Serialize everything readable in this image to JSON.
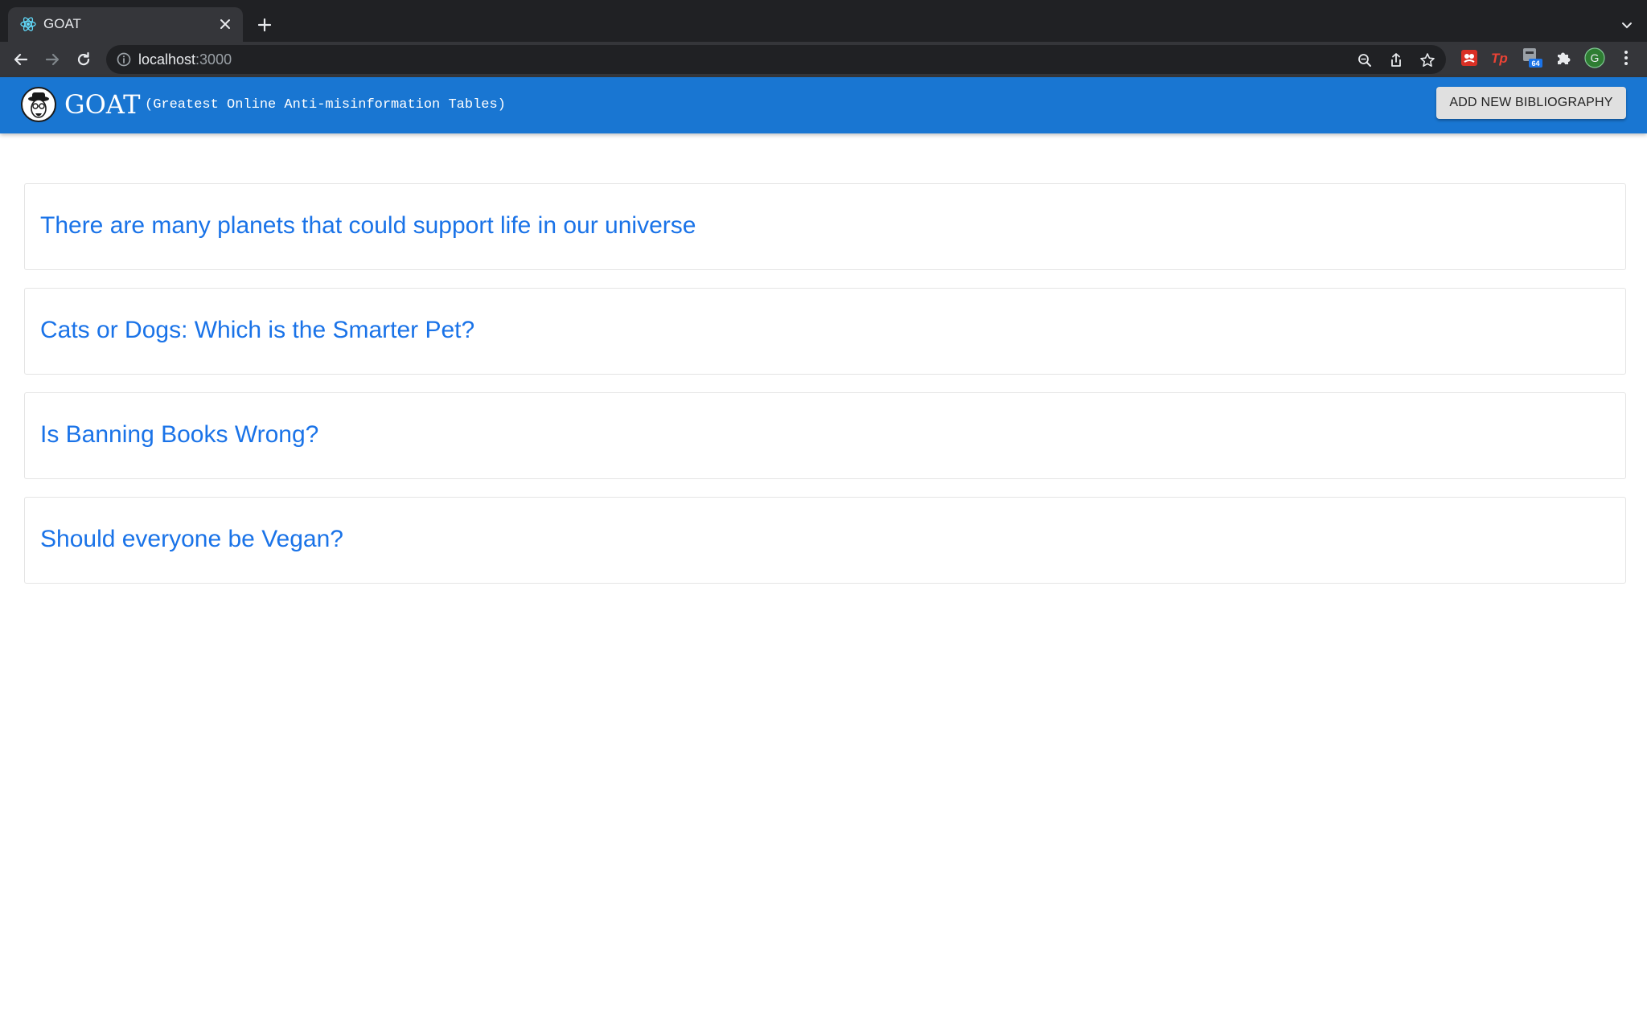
{
  "browser": {
    "tab_title": "GOAT",
    "url_host": "localhost",
    "url_port": ":3000",
    "extension_badge": "64",
    "profile_initial": "G",
    "colors": {
      "chrome_dark": "#202124",
      "toolbar": "#35363a",
      "profile_bg": "#2e7d32"
    }
  },
  "header": {
    "brand": "GOAT",
    "tagline": "(Greatest Online Anti-misinformation Tables)",
    "add_button_label": "ADD NEW BIBLIOGRAPHY",
    "colors": {
      "app_bar": "#1976d2",
      "title_link": "#1a73e8"
    }
  },
  "bibliographies": [
    {
      "title": "There are many planets that could support life in our universe"
    },
    {
      "title": "Cats or Dogs: Which is the Smarter Pet?"
    },
    {
      "title": "Is Banning Books Wrong?"
    },
    {
      "title": "Should everyone be Vegan?"
    }
  ]
}
